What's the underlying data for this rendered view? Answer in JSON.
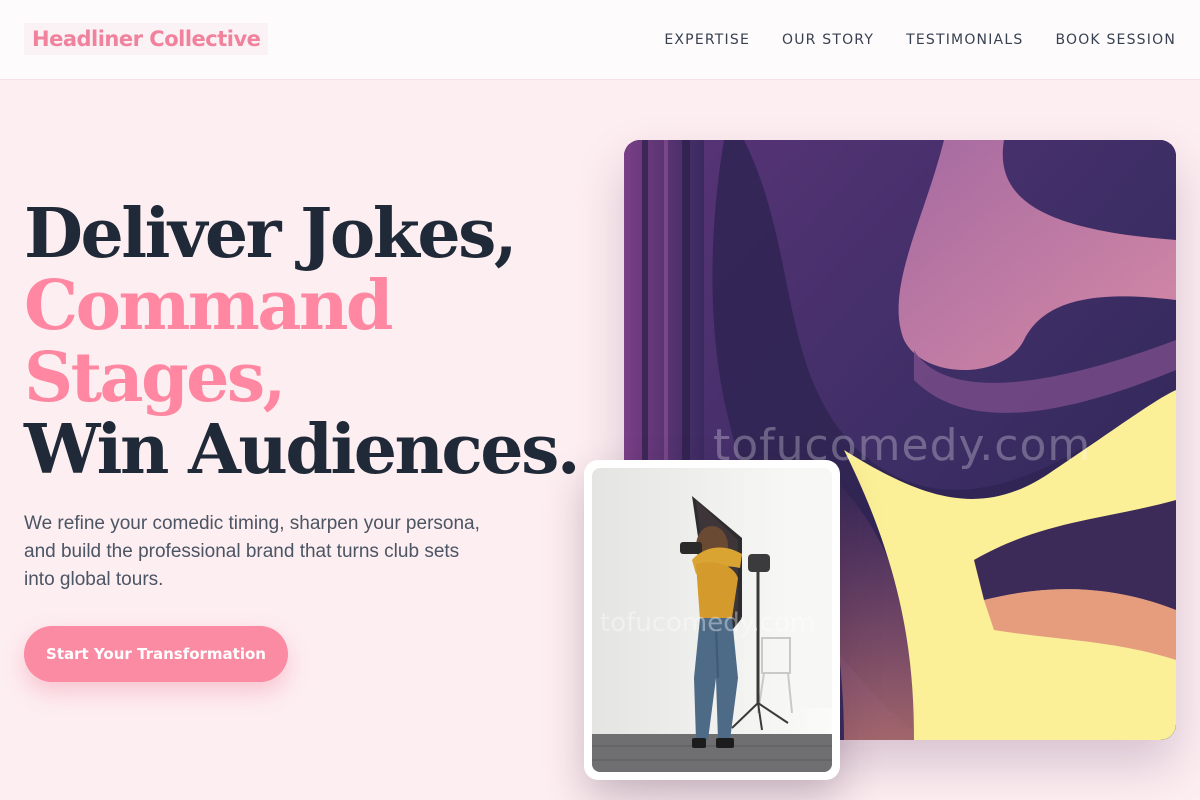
{
  "nav": {
    "brand": "Headliner Collective",
    "links": [
      "EXPERTISE",
      "OUR STORY",
      "TESTIMONIALS",
      "BOOK SESSION"
    ]
  },
  "hero": {
    "headline": {
      "line1": "Deliver Jokes,",
      "line2": "Command",
      "line3": "Stages,",
      "line4": "Win Audiences."
    },
    "subtext": "We refine your comedic timing, sharpen your persona, and build the professional brand that turns club sets into global tours.",
    "cta_label": "Start Your Transformation"
  },
  "watermark": "tofucomedy.com",
  "colors": {
    "accent_pink": "#ff87a1",
    "button_pink": "#fb8aa3",
    "dark_text": "#1f2937",
    "page_bg": "#fdeef1"
  }
}
